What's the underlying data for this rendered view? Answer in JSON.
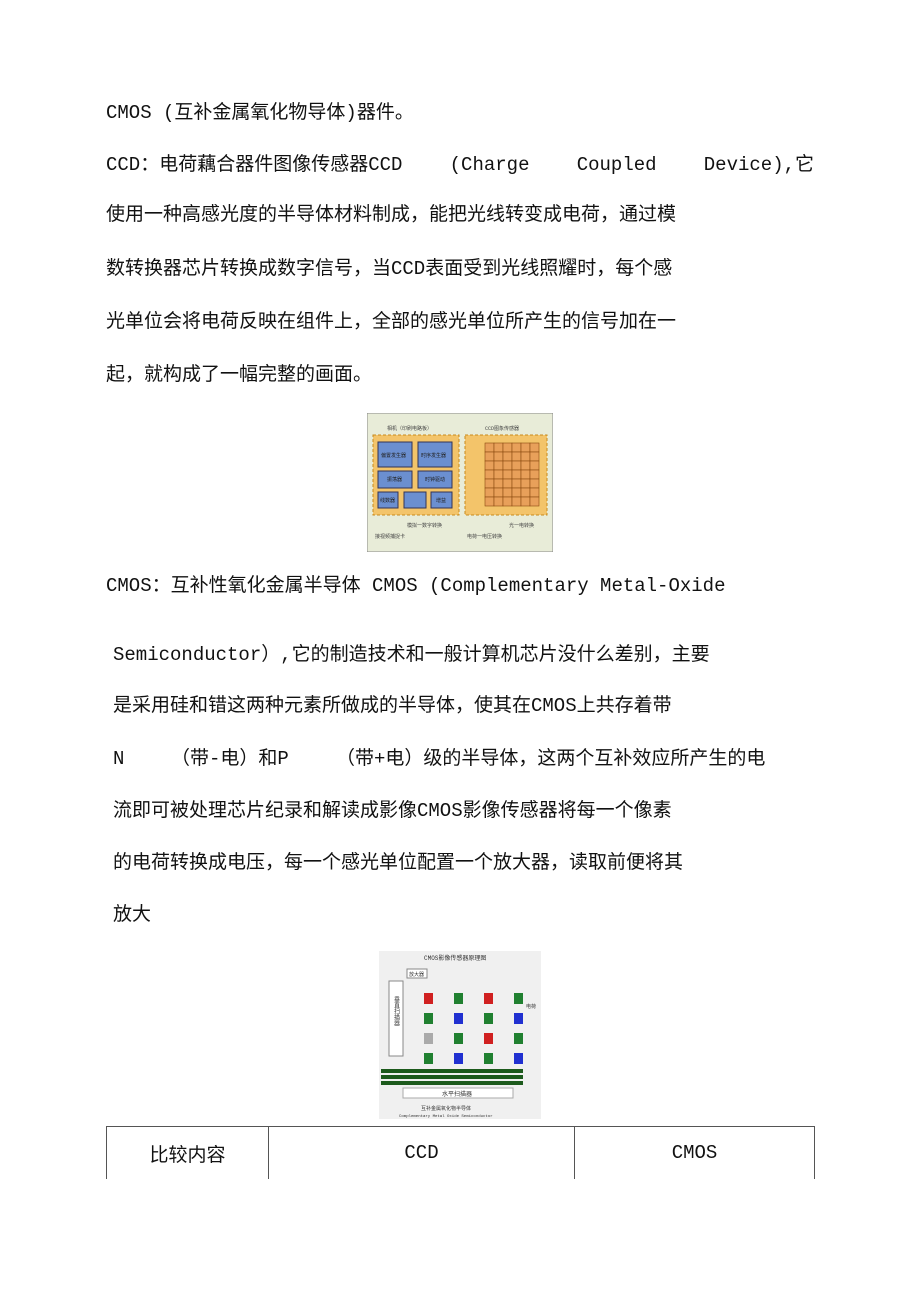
{
  "paragraphs": {
    "intro": "CMOS (互补金属氧化物导体)器件。",
    "ccd": [
      [
        "CCD：电荷藕合器件图像传感器CCD",
        "(Charge",
        "Coupled",
        "Device),它"
      ],
      "使用一种高感光度的半导体材料制成，能把光线转变成电荷，通过模",
      "数转换器芯片转换成数字信号，当CCD表面受到光线照耀时，每个感",
      "光单位会将电荷反映在组件上，全部的感光单位所产生的信号加在一",
      "起，就构成了一幅完整的画面。"
    ],
    "cmos_head": "CMOS：互补性氧化金属半导体 CMOS (Complementary Metal-Oxide",
    "cmos": [
      "Semiconductor）,它的制造技术和一般计算机芯片没什么差别，主要",
      "是采用硅和错这两种元素所做成的半导体，使其在CMOS上共存着带",
      [
        "N",
        "（带-电）和P",
        "（带+电）级的半导体，这两个互补效应所产生的电"
      ],
      "流即可被处理芯片纪录和解读成影像CMOS影像传感器将每一个像素",
      "的电荷转换成电压，每一个感光单位配置一个放大器，读取前便将其",
      "放大"
    ]
  },
  "figure_ccd": {
    "labels": [
      "相机（印刷电路板）",
      "CCD图象传感器",
      "偏置发生器",
      "时序发生器",
      "振荡器",
      "时钟驱动",
      "线数器",
      "增益",
      "模拟一数字转换",
      "光一电转换",
      "电荷一电压转换",
      "接视频捕捉卡"
    ]
  },
  "figure_cmos": {
    "labels": [
      "CMOS影像传感器原理图",
      "放大器",
      "电荷",
      "垂直扫描器",
      "水平扫描器",
      "互补金属氧化物半导体",
      "Complementary Metal Oxide Semiconductor"
    ]
  },
  "table": {
    "headers": [
      "比较内容",
      "CCD",
      "CMOS"
    ]
  }
}
